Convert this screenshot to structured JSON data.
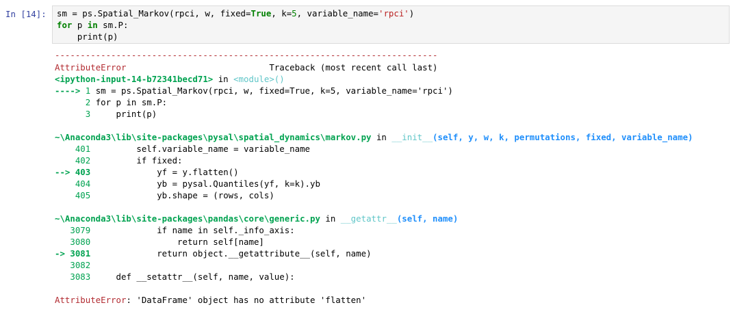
{
  "cell": {
    "prompt": "In [14]:",
    "code_lines": [
      [
        "sm = ps.Spatial_Markov(rpci, w, fixed=",
        "True",
        ", k=",
        "5",
        ", variable_name=",
        "'rpci'",
        ")"
      ],
      [
        "for",
        " p ",
        "in",
        " sm.P:"
      ],
      [
        "    print(p)"
      ]
    ]
  },
  "output": {
    "separator": "---------------------------------------------------------------------------",
    "error_name": "AttributeError",
    "traceback_header": "Traceback (most recent call last)",
    "frames": [
      {
        "location": "<ipython-input-14-b72341becd71>",
        "in_text": " in ",
        "func": "<module>()",
        "lines": [
          {
            "arrow": "----> ",
            "no": "1",
            "code": " sm = ps.Spatial_Markov(rpci, w, fixed=True, k=5, variable_name='rpci')"
          },
          {
            "arrow": "      ",
            "no": "2",
            "code": " for p in sm.P:"
          },
          {
            "arrow": "      ",
            "no": "3",
            "code": "     print(p)"
          }
        ]
      },
      {
        "location": "~\\Anaconda3\\lib\\site-packages\\pysal\\spatial_dynamics\\markov.py",
        "in_text": " in ",
        "func": "__init__",
        "args": "(self, y, w, k, permutations, fixed, variable_name)",
        "lines": [
          {
            "arrow": "    ",
            "no": "401",
            "code": "         self.variable_name = variable_name"
          },
          {
            "arrow": "    ",
            "no": "402",
            "code": "         if fixed:"
          },
          {
            "arrow": "--> ",
            "no": "403",
            "code": "             yf = y.flatten()"
          },
          {
            "arrow": "    ",
            "no": "404",
            "code": "             yb = pysal.Quantiles(yf, k=k).yb"
          },
          {
            "arrow": "    ",
            "no": "405",
            "code": "             yb.shape = (rows, cols)"
          }
        ]
      },
      {
        "location": "~\\Anaconda3\\lib\\site-packages\\pandas\\core\\generic.py",
        "in_text": " in ",
        "func": "__getattr__",
        "args": "(self, name)",
        "lines": [
          {
            "arrow": "   ",
            "no": "3079",
            "code": "             if name in self._info_axis:"
          },
          {
            "arrow": "   ",
            "no": "3080",
            "code": "                 return self[name]"
          },
          {
            "arrow": "-> ",
            "no": "3081",
            "code": "             return object.__getattribute__(self, name)"
          },
          {
            "arrow": "   ",
            "no": "3082",
            "code": ""
          },
          {
            "arrow": "   ",
            "no": "3083",
            "code": "     def __setattr__(self, name, value):"
          }
        ]
      }
    ],
    "final_error_name": "AttributeError",
    "final_error_msg": ": 'DataFrame' object has no attribute 'flatten'"
  }
}
